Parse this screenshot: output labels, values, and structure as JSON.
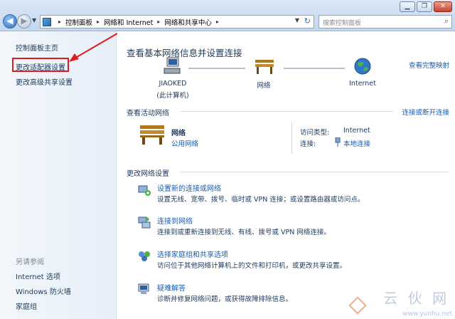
{
  "window_controls": {
    "minimize": "▁",
    "restore": "❐",
    "close": "✕"
  },
  "address_bar": {
    "segments": [
      "控制面板",
      "网络和 Internet",
      "网络和共享中心"
    ],
    "separator": "▸",
    "refresh_glyph": "↻"
  },
  "search": {
    "placeholder": "搜索控制面板",
    "glyph": "⌕"
  },
  "left_pane": {
    "items": [
      "控制面板主页",
      "更改适配器设置",
      "更改高级共享设置"
    ],
    "see_also_title": "另请参阅",
    "see_also": [
      "Internet 选项",
      "Windows 防火墙",
      "家庭组"
    ]
  },
  "main": {
    "title": "查看基本网络信息并设置连接",
    "full_map_link": "查看完整映射",
    "net_map": {
      "computer_name": "JIAOKED",
      "computer_sub": "(此计算机)",
      "network": "网络",
      "internet": "Internet"
    },
    "active_section": {
      "title": "查看活动网络",
      "link": "连接或断开连接",
      "network_name": "网络",
      "network_type": "公用网络",
      "access_type_label": "访问类型:",
      "access_type_value": "Internet",
      "connection_label": "连接:",
      "connection_value": "本地连接"
    },
    "change_section": {
      "title": "更改网络设置",
      "tasks": [
        {
          "link": "设置新的连接或网络",
          "desc": "设置无线、宽带、拨号、临时或 VPN 连接；或设置路由器或访问点。"
        },
        {
          "link": "连接到网络",
          "desc": "连接到或重新连接到无线、有线、拨号或 VPN 网络连接。"
        },
        {
          "link": "选择家庭组和共享选项",
          "desc": "访问位于其他网络计算机上的文件和打印机，或更改共享设置。"
        },
        {
          "link": "疑难解答",
          "desc": "诊断并修复网络问题，或获得故障排除信息。"
        }
      ]
    }
  },
  "watermark": {
    "big": "云 伙 网",
    "url": "www.yunhu.net"
  },
  "colors": {
    "link": "#1a5cb0",
    "text": "#1e395b",
    "highlight": "#e01b1b"
  }
}
